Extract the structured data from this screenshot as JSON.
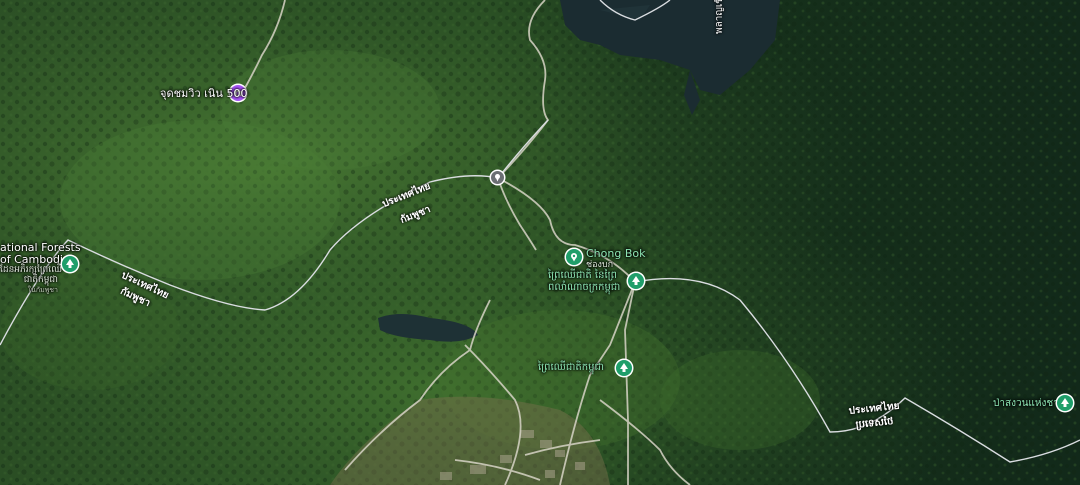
{
  "map": {
    "base_colors": {
      "forest_dark": "#14301a",
      "forest_mid": "#2f5a2a",
      "forest_light": "#4f7c38",
      "water": "#1c2d33",
      "road": "#d9dcd6",
      "farmland": "#8a7a56"
    },
    "border_labels": [
      {
        "line1": "ประเทศไทย",
        "line2": "กัมพูชา"
      },
      {
        "line1": "ประเทศไทย",
        "line2": "กัมพูชา"
      },
      {
        "line1": "ประเทศไทย",
        "line2": "ប្រទេសថៃ"
      }
    ],
    "pois": [
      {
        "name": "จุดชมวิว เนิน 500",
        "icon": "viewpoint-icon",
        "color": "#a855f7"
      },
      {
        "name": "National Forests of Cambodia",
        "line1": "ational Forests",
        "line2": "of Cambodia",
        "sub1": "ដែនអភិរក្សព្រៃឈើ",
        "sub2": "ជាតិកម្ពុជា",
        "sub3": "ในกัมพูชา",
        "icon": "tree-icon",
        "color": "#1f9e6a"
      },
      {
        "name": "Chong Bok",
        "sub": "ช่องบก",
        "icon": "place-icon",
        "color": "#1f9e6a"
      },
      {
        "name": "ព្រៃឈើជាតិ នៃព្រៃ",
        "line2": "ពលាំណាចក្រកម្ពុជា",
        "icon": "tree-icon",
        "color": "#1f9e6a"
      },
      {
        "name": "ព្រៃឈើជាតិកម្ពុជា",
        "icon": "tree-icon",
        "color": "#1f9e6a"
      },
      {
        "name": "ป่าสงวนแห่งชาติ",
        "icon": "tree-icon",
        "color": "#1f9e6a"
      }
    ],
    "water_label": "พลาญเขือง",
    "junction": {
      "icon": "pin-icon"
    }
  }
}
